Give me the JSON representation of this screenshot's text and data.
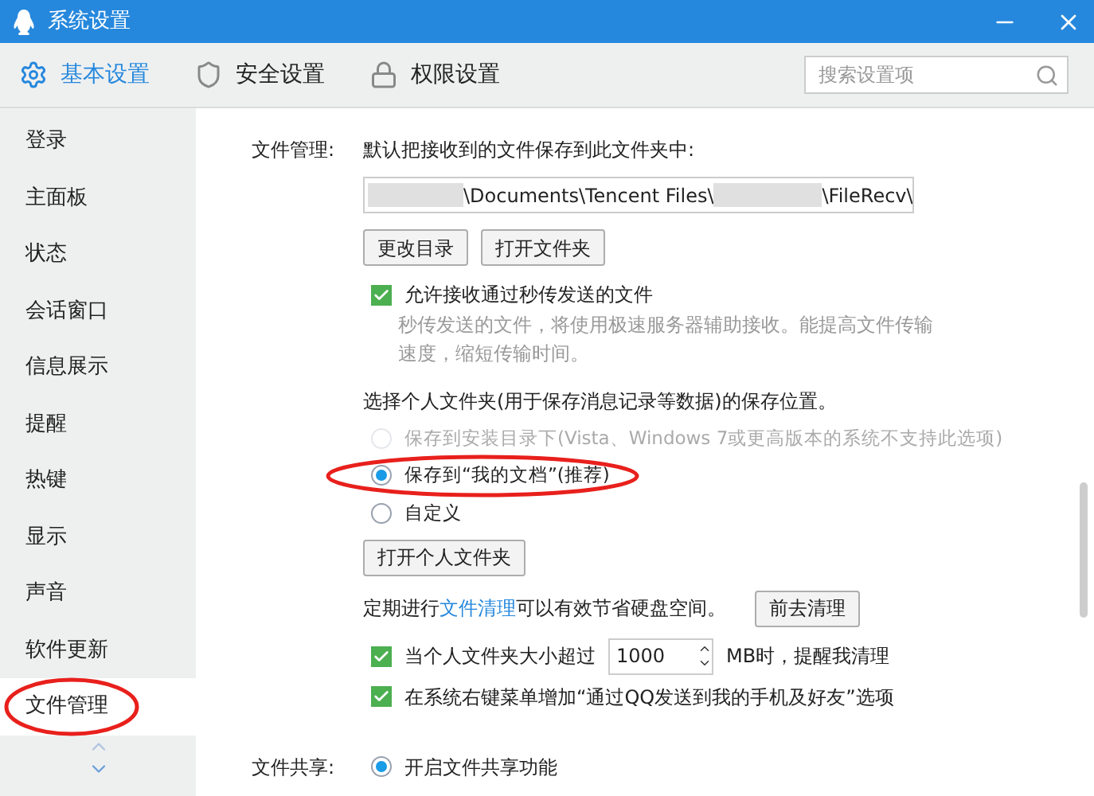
{
  "window": {
    "title": "系统设置"
  },
  "tabs": [
    {
      "label": "基本设置",
      "selected": true,
      "kind": "gear"
    },
    {
      "label": "安全设置",
      "selected": false,
      "kind": "shield"
    },
    {
      "label": "权限设置",
      "selected": false,
      "kind": "lock"
    }
  ],
  "search": {
    "placeholder": "搜索设置项"
  },
  "sidebar": {
    "items": [
      {
        "label": "登录",
        "selected": false
      },
      {
        "label": "主面板",
        "selected": false
      },
      {
        "label": "状态",
        "selected": false
      },
      {
        "label": "会话窗口",
        "selected": false
      },
      {
        "label": "信息展示",
        "selected": false
      },
      {
        "label": "提醒",
        "selected": false
      },
      {
        "label": "热键",
        "selected": false
      },
      {
        "label": "显示",
        "selected": false
      },
      {
        "label": "声音",
        "selected": false
      },
      {
        "label": "软件更新",
        "selected": false
      },
      {
        "label": "文件管理",
        "selected": true
      }
    ]
  },
  "file_management": {
    "label": "文件管理:",
    "heading": "默认把接收到的文件保存到此文件夹中:",
    "path": {
      "parts": [
        "\\Documents\\Tencent Files\\",
        "\\FileRecv\\"
      ]
    },
    "buttons": [
      "更改目录",
      "打开文件夹"
    ],
    "fast_transfer": {
      "label": "允许接收通过秒传发送的文件",
      "checked": true,
      "description": "秒传发送的文件，将使用极速服务器辅助接收。能提高文件传输速度，缩短传输时间。"
    },
    "personal_folder": {
      "heading": "选择个人文件夹(用于保存消息记录等数据)的保存位置。",
      "options": [
        {
          "label": "保存到安装目录下(Vista、Windows 7或更高版本的系统不支持此选项)",
          "selected": false,
          "disabled": true
        },
        {
          "label": "保存到“我的文档”(推荐)",
          "selected": true,
          "disabled": false
        },
        {
          "label": "自定义",
          "selected": false,
          "disabled": false
        }
      ],
      "button": "打开个人文件夹"
    },
    "cleanup": {
      "before": "定期进行",
      "link": "文件清理",
      "after": "可以有效节省硬盘空间。",
      "button": "前去清理"
    },
    "size_alert": {
      "before": "当个人文件夹大小超过",
      "value": "1000",
      "after": "MB时，提醒我清理",
      "checked": true
    },
    "context_menu": {
      "label": "在系统右键菜单增加“通过QQ发送到我的手机及好友”选项",
      "checked": true
    }
  },
  "file_sharing": {
    "label": "文件共享:",
    "options": [
      {
        "label": "开启文件共享功能",
        "selected": true
      }
    ]
  }
}
